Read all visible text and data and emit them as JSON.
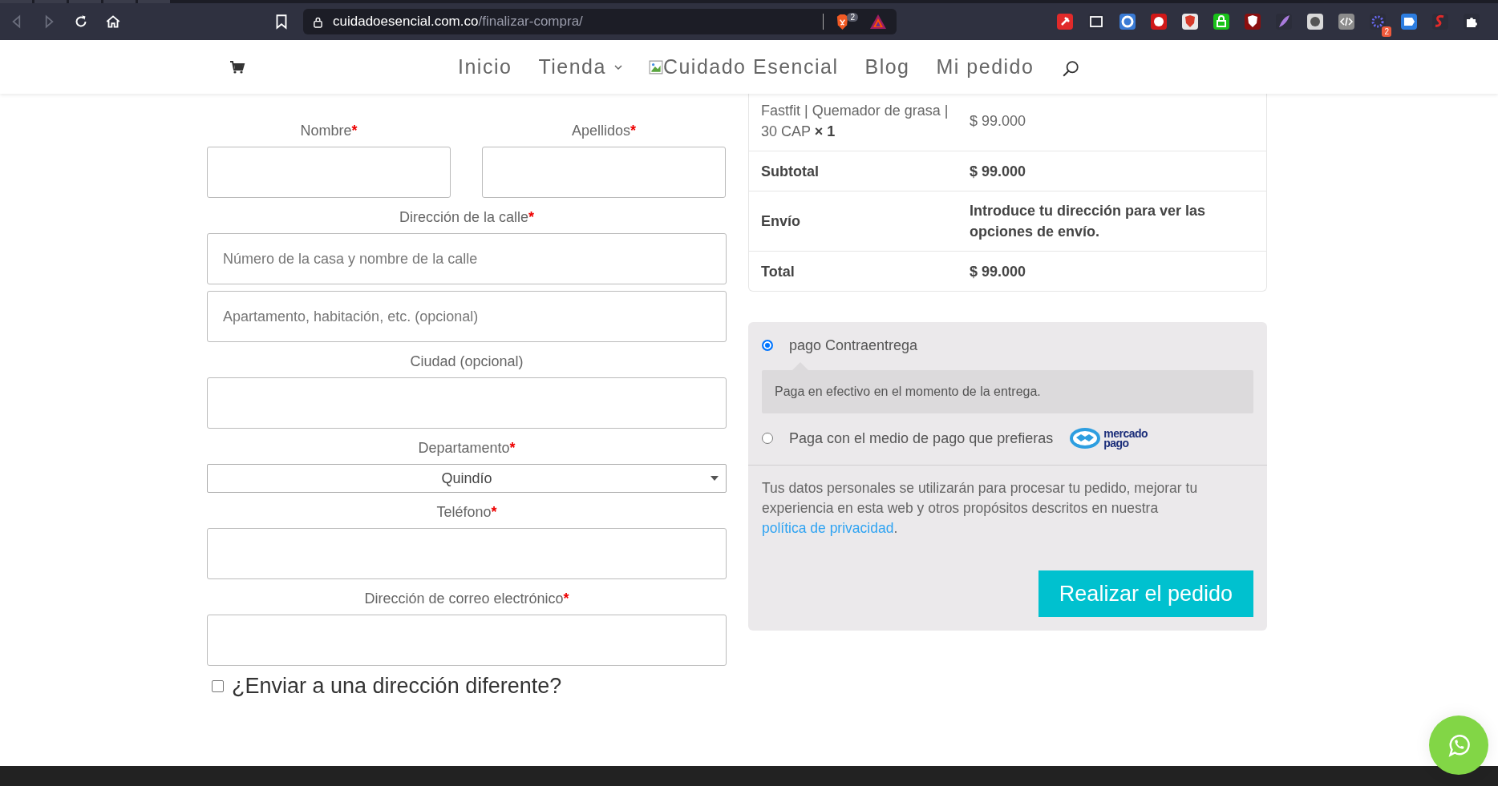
{
  "browser": {
    "url_host": "cuidadoesencial.com.co",
    "url_path": "/finalizar-compra/",
    "brave_badge": "2",
    "extension_badge": "2"
  },
  "nav": {
    "items": [
      {
        "label": "Inicio",
        "kind": "link"
      },
      {
        "label": "Tienda",
        "kind": "dropdown"
      },
      {
        "label": "Cuidado Esencial",
        "kind": "logo"
      },
      {
        "label": "Blog",
        "kind": "link"
      },
      {
        "label": "Mi pedido",
        "kind": "link"
      }
    ]
  },
  "billing_fields": [
    {
      "kind": "text",
      "label": "Nombre",
      "required": true,
      "half": true
    },
    {
      "kind": "text",
      "label": "Apellidos",
      "required": true,
      "half": true
    },
    {
      "kind": "text",
      "label": "Dirección de la calle",
      "required": true,
      "placeholder": "Número de la casa y nombre de la calle"
    },
    {
      "kind": "text",
      "placeholder": "Apartamento, habitación, etc. (opcional)"
    },
    {
      "kind": "text",
      "label": "Ciudad (opcional)",
      "required": false
    },
    {
      "kind": "select",
      "label": "Departamento",
      "required": true,
      "value": "Quindío"
    },
    {
      "kind": "text",
      "label": "Teléfono",
      "required": true
    },
    {
      "kind": "text",
      "label": "Dirección de correo electrónico",
      "required": true
    }
  ],
  "required_mark": "*",
  "ship_to_different": {
    "label": "¿Enviar a una dirección diferente?",
    "checked": false
  },
  "order_rows": [
    {
      "kind": "product",
      "name": "Fastfit | Quemador de grasa | 30 CAP",
      "qty": "× 1",
      "value": "$ 99.000"
    },
    {
      "kind": "total",
      "label": "Subtotal",
      "value": "$ 99.000"
    },
    {
      "kind": "total",
      "label": "Envío",
      "value": "Introduce tu dirección para ver las opciones de envío."
    },
    {
      "kind": "total",
      "label": "Total",
      "value": "$ 99.000"
    }
  ],
  "payment_methods": [
    {
      "label": "pago Contraentrega",
      "selected": true,
      "description": "Paga en efectivo en el momento de la entrega."
    },
    {
      "label": "Paga con el medio de pago que prefieras",
      "selected": false,
      "logo_text": [
        "mercado",
        "pago"
      ]
    }
  ],
  "privacy": {
    "text": "Tus datos personales se utilizarán para procesar tu pedido, mejorar tu experiencia en esta web y otros propósitos descritos en nuestra ",
    "link": "política de privacidad",
    "end": "."
  },
  "place_order": "Realizar el pedido"
}
